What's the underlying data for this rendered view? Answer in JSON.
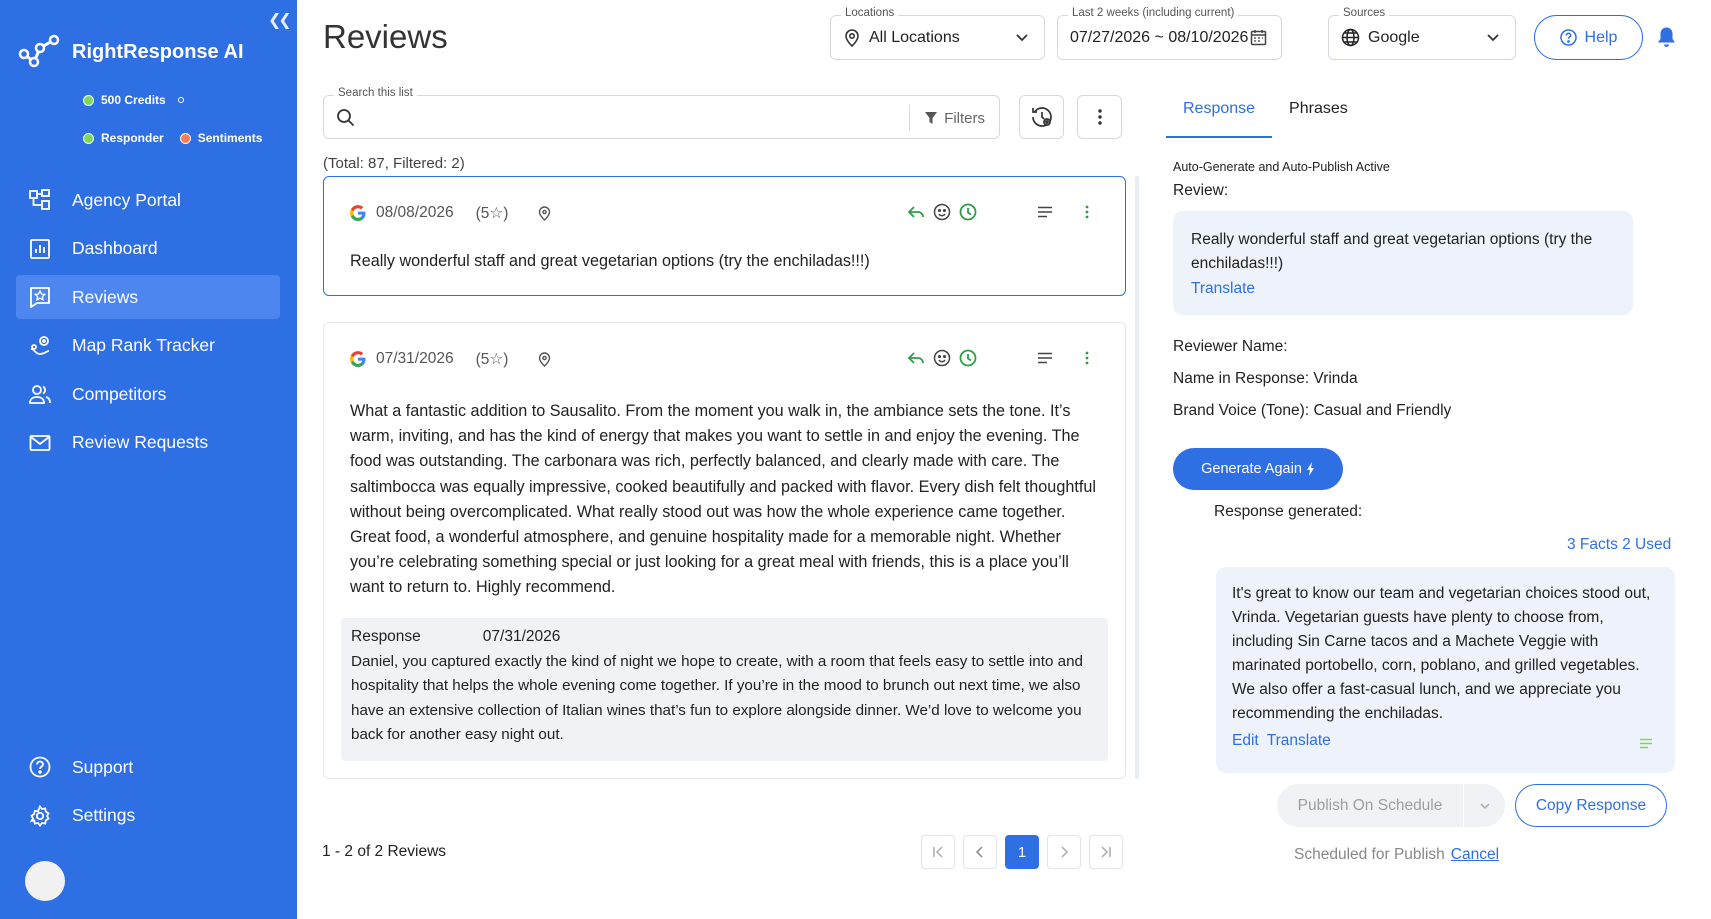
{
  "app": {
    "brand": "RightResponse AI",
    "credits": "500 Credits",
    "feature_responder": "Responder",
    "feature_sentiments": "Sentiments"
  },
  "sidebar": {
    "items": [
      {
        "label": "Agency Portal",
        "icon": "agency-portal-icon"
      },
      {
        "label": "Dashboard",
        "icon": "dashboard-icon"
      },
      {
        "label": "Reviews",
        "icon": "reviews-icon",
        "active": true
      },
      {
        "label": "Map Rank Tracker",
        "icon": "map-rank-icon"
      },
      {
        "label": "Competitors",
        "icon": "competitors-icon"
      },
      {
        "label": "Review Requests",
        "icon": "mail-icon"
      }
    ],
    "bottom": [
      {
        "label": "Support",
        "icon": "question-circle-icon"
      },
      {
        "label": "Settings",
        "icon": "gear-icon"
      }
    ]
  },
  "header": {
    "title": "Reviews",
    "locations_label": "Locations",
    "locations_value": "All Locations",
    "daterange_label": "Last 2 weeks (including current)",
    "daterange_value": "07/27/2026 ~ 08/10/2026",
    "sources_label": "Sources",
    "sources_value": "Google",
    "help": "Help"
  },
  "list": {
    "search_label": "Search this list",
    "search_value": "",
    "filters": "Filters",
    "totals": "(Total: 87, Filtered: 2)",
    "reviews": [
      {
        "date": "08/08/2026",
        "rating": "(5☆)",
        "text": "Really wonderful staff and great vegetarian options (try the enchiladas!!!)"
      },
      {
        "date": "07/31/2026",
        "rating": "(5☆)",
        "text": "What a fantastic addition to Sausalito. From the moment you walk in, the ambiance sets the tone. It’s warm, inviting, and has the kind of energy that makes you want to settle in and enjoy the evening. The food was outstanding. The carbonara was rich, perfectly balanced, and clearly made with care. The saltimbocca was equally impressive, cooked beautifully and packed with flavor. Every dish felt thoughtful without being overcomplicated. What really stood out was how the whole experience came together. Great food, a wonderful atmosphere, and genuine hospitality made for a memorable night. Whether you’re celebrating something special or just looking for a great meal with friends, this is a place you’ll want to return to. Highly recommend.",
        "response_label": "Response",
        "response_date": "07/31/2026",
        "response_text": "Daniel, you captured exactly the kind of night we hope to create, with a room that feels easy to settle into and hospitality that helps the whole evening come together. If you’re in the mood to brunch out next time, we also have an extensive collection of Italian wines that’s fun to explore alongside dinner. We’d love to welcome you back for another easy night out."
      }
    ],
    "pager_info": "1 - 2 of 2 Reviews",
    "current_page": "1"
  },
  "panel": {
    "tab_response": "Response",
    "tab_phrases": "Phrases",
    "auto_status": "Auto-Generate and Auto-Publish Active",
    "review_label": "Review:",
    "review_text": "Really wonderful staff and great vegetarian options (try the enchiladas!!!)",
    "translate": "Translate",
    "reviewer_name_label": "Reviewer Name:",
    "name_in_response_label": "Name in Response:",
    "name_in_response_value": " Vrinda",
    "brand_voice_label": "Brand Voice (Tone):",
    "brand_voice_value": " Casual and Friendly",
    "generate_again": "Generate Again",
    "response_generated": "Response generated:",
    "facts": "3 Facts 2 Used",
    "generated_text": "It's great to know our team and vegetarian choices stood out, Vrinda. Vegetarian guests have plenty to choose from, including Sin Carne tacos and a Machete Veggie with marinated portobello, corn, poblano, and grilled vegetables. We also offer a fast-casual lunch, and we appreciate you recommending the enchiladas.",
    "edit": "Edit",
    "translate2": "Translate",
    "publish_on_schedule": "Publish On Schedule",
    "copy_response": "Copy Response",
    "scheduled": "Scheduled for Publish",
    "cancel": "Cancel"
  },
  "colors": {
    "brand_blue": "#2f6fe4",
    "active_nav": "#4d86ee",
    "green_icon": "#2e9e46"
  }
}
